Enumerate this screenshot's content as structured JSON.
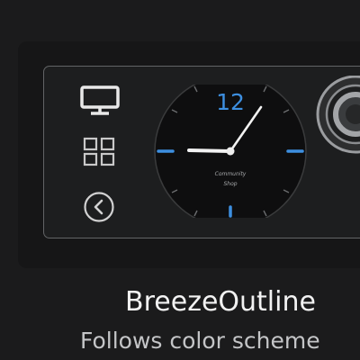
{
  "theme": {
    "name": "BreezeOutline",
    "description": "Follows color scheme"
  },
  "preview": {
    "icons": [
      "monitor-icon",
      "app-grid-icon",
      "back-arrow-icon"
    ],
    "clock": {
      "numeral": "12",
      "brand_line_1": "Community",
      "brand_line_2": "Shop"
    }
  },
  "colors": {
    "background": "#1b1b1c",
    "tile": "#161617",
    "accent_blue": "#3d8fe0",
    "text": "#f2f2f2",
    "subtext": "#c4c5c7"
  }
}
